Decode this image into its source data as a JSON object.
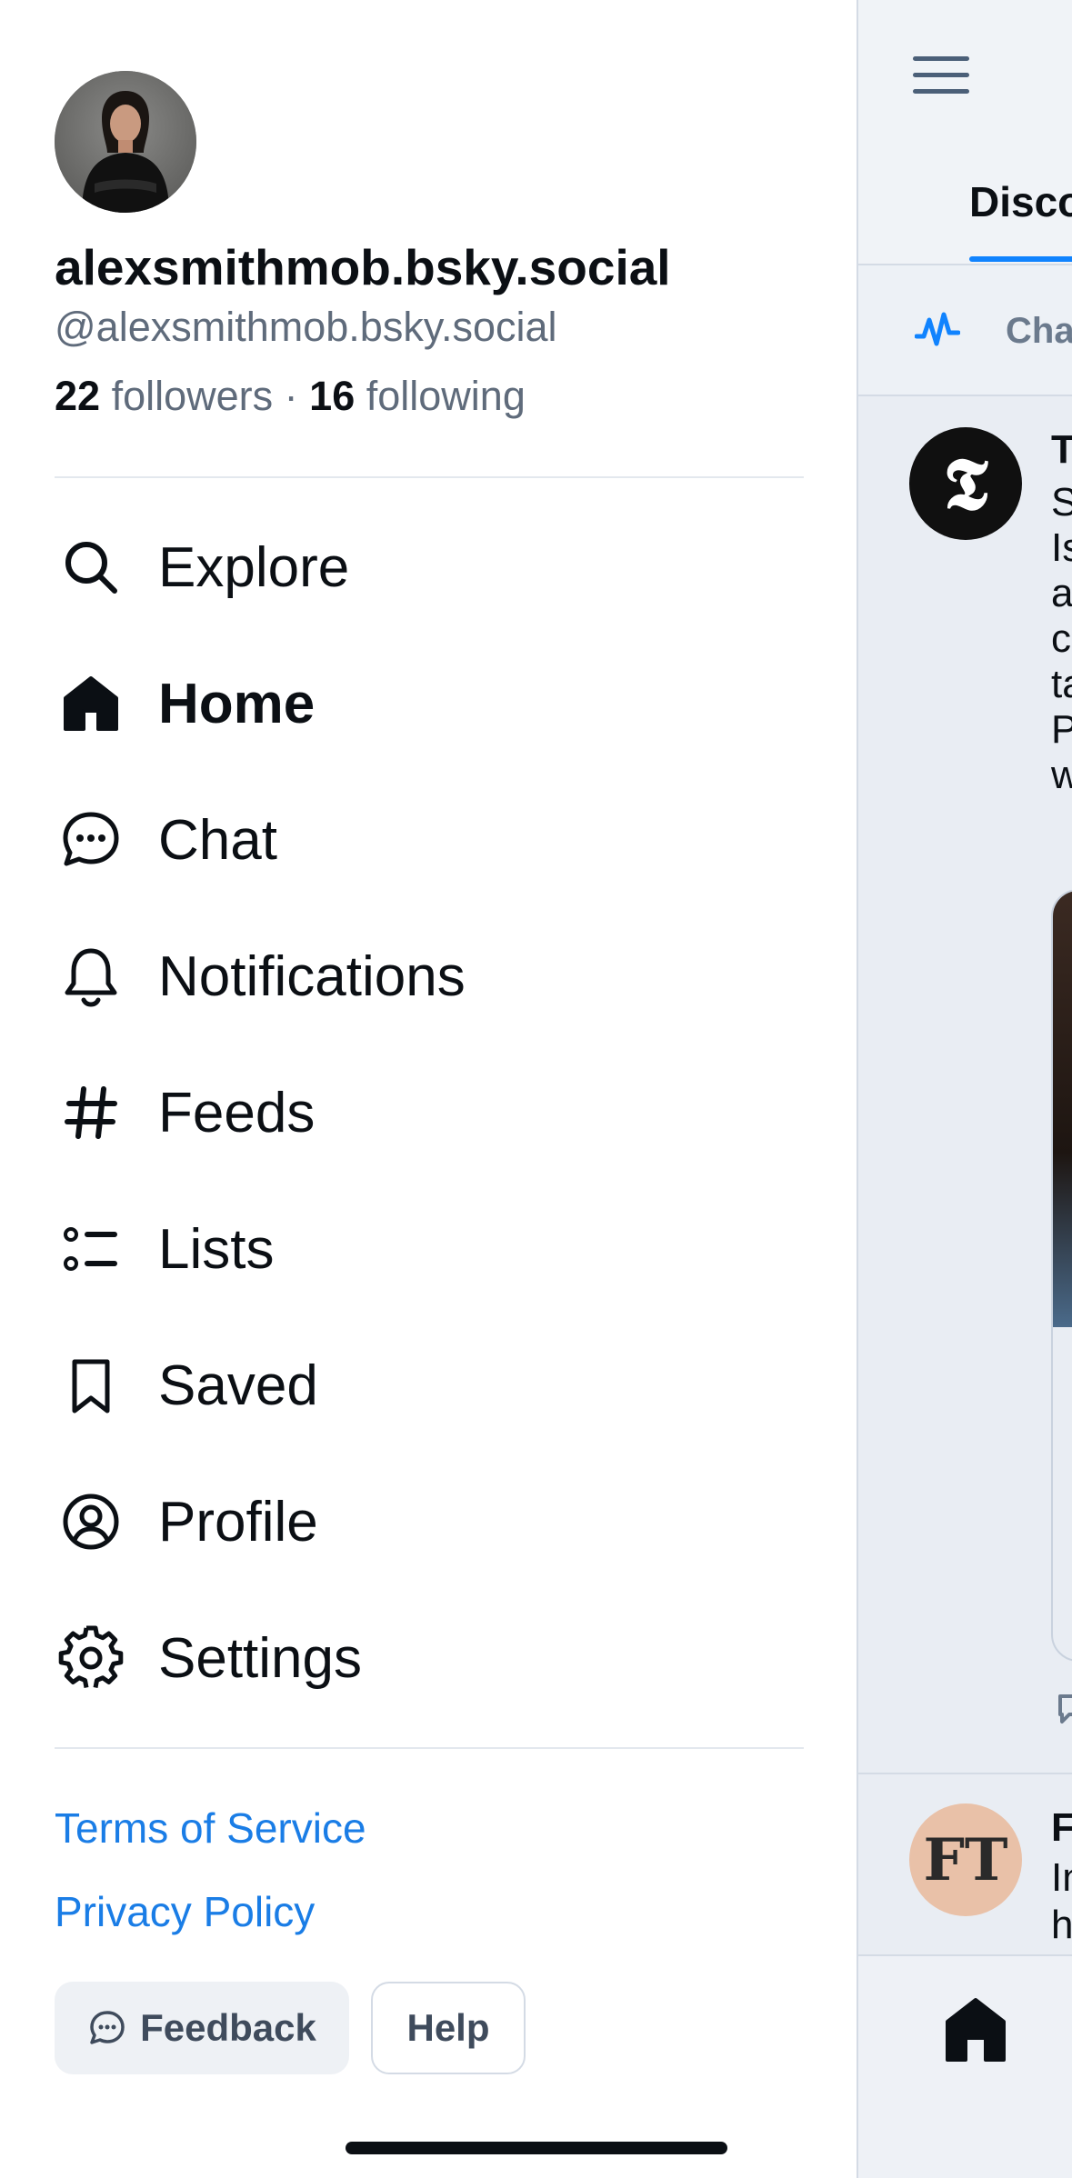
{
  "profile": {
    "display_name": "alexsmithmob.bsky.social",
    "handle": "@alexsmithmob.bsky.social",
    "followers_count": "22",
    "followers_label": "followers",
    "separator": "·",
    "following_count": "16",
    "following_label": "following"
  },
  "nav": {
    "items": [
      {
        "label": "Explore",
        "icon": "search-icon"
      },
      {
        "label": "Home",
        "icon": "home-icon",
        "active": true
      },
      {
        "label": "Chat",
        "icon": "chat-bubble-icon"
      },
      {
        "label": "Notifications",
        "icon": "bell-icon"
      },
      {
        "label": "Feeds",
        "icon": "hashtag-icon"
      },
      {
        "label": "Lists",
        "icon": "list-icon"
      },
      {
        "label": "Saved",
        "icon": "bookmark-icon"
      },
      {
        "label": "Profile",
        "icon": "user-circle-icon"
      },
      {
        "label": "Settings",
        "icon": "gear-icon"
      }
    ]
  },
  "links": {
    "terms": "Terms of Service",
    "privacy": "Privacy Policy"
  },
  "buttons": {
    "feedback": "Feedback",
    "help": "Help"
  },
  "background": {
    "tab_label": "Disco",
    "chart_label": "Cha",
    "post1_initial": "T",
    "post1_avatar_glyph": "𝕿",
    "post1_lines": [
      "S",
      "Is",
      "a",
      "c",
      "ta",
      "P",
      "w"
    ],
    "post2_avatar_text": "FT",
    "post2_initial": "F",
    "post2_lines": [
      "In",
      "h"
    ]
  },
  "colors": {
    "accent": "#1083fe",
    "link": "#1a7de6",
    "text_primary": "#0b0f14",
    "text_secondary": "#5f6b7b"
  }
}
